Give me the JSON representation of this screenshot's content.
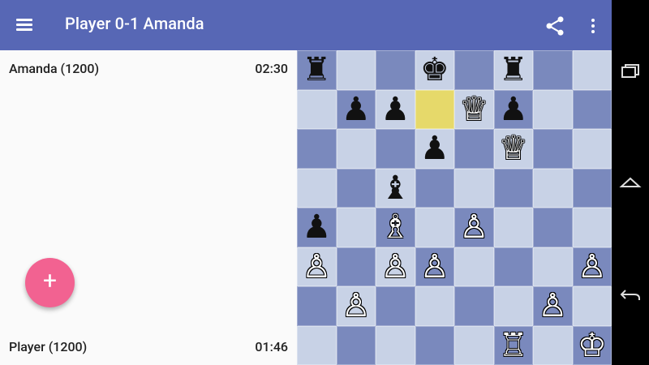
{
  "appbar": {
    "title": "Player 0-1 Amanda",
    "menu_icon": "hamburger-menu-icon",
    "share_icon": "share-icon",
    "more_icon": "more-vert-icon"
  },
  "players": {
    "top": {
      "name": "Amanda (1200)",
      "clock": "02:30"
    },
    "bottom": {
      "name": "Player (1200)",
      "clock": "01:46"
    }
  },
  "fab": {
    "label": "+",
    "icon": "add-icon"
  },
  "board": {
    "highlight": [
      "d7"
    ],
    "pieces": [
      {
        "sq": "a8",
        "glyph": "♜",
        "color": "b",
        "name": "black-rook"
      },
      {
        "sq": "d8",
        "glyph": "♚",
        "color": "b",
        "name": "black-king"
      },
      {
        "sq": "f8",
        "glyph": "♜",
        "color": "b",
        "name": "black-rook"
      },
      {
        "sq": "b7",
        "glyph": "♟",
        "color": "b",
        "name": "black-pawn"
      },
      {
        "sq": "c7",
        "glyph": "♟",
        "color": "b",
        "name": "black-pawn"
      },
      {
        "sq": "e7",
        "glyph": "♕",
        "color": "w",
        "name": "white-queen"
      },
      {
        "sq": "f7",
        "glyph": "♟",
        "color": "b",
        "name": "black-pawn"
      },
      {
        "sq": "d6",
        "glyph": "♟",
        "color": "b",
        "name": "black-pawn"
      },
      {
        "sq": "f6",
        "glyph": "♕",
        "color": "w",
        "name": "white-queen"
      },
      {
        "sq": "c5",
        "glyph": "♝",
        "color": "b",
        "name": "black-bishop"
      },
      {
        "sq": "a4",
        "glyph": "♟",
        "color": "b",
        "name": "black-pawn"
      },
      {
        "sq": "c4",
        "glyph": "♗",
        "color": "w",
        "name": "white-bishop"
      },
      {
        "sq": "e4",
        "glyph": "♙",
        "color": "w",
        "name": "white-pawn"
      },
      {
        "sq": "a3",
        "glyph": "♙",
        "color": "w",
        "name": "white-pawn"
      },
      {
        "sq": "c3",
        "glyph": "♙",
        "color": "w",
        "name": "white-pawn"
      },
      {
        "sq": "d3",
        "glyph": "♙",
        "color": "w",
        "name": "white-pawn"
      },
      {
        "sq": "h3",
        "glyph": "♙",
        "color": "w",
        "name": "white-pawn"
      },
      {
        "sq": "b2",
        "glyph": "♙",
        "color": "w",
        "name": "white-pawn"
      },
      {
        "sq": "g2",
        "glyph": "♙",
        "color": "w",
        "name": "white-pawn"
      },
      {
        "sq": "f1",
        "glyph": "♖",
        "color": "w",
        "name": "white-rook"
      },
      {
        "sq": "h1",
        "glyph": "♔",
        "color": "w",
        "name": "white-king"
      }
    ]
  },
  "colors": {
    "appbar": "#5767b5",
    "fab": "#f26291",
    "light_square": "#c8d2e6",
    "dark_square": "#7a89bd",
    "highlight": "#e6d96a"
  },
  "system_nav": {
    "recents_icon": "recents-icon",
    "home_icon": "home-icon",
    "back_icon": "back-icon"
  }
}
